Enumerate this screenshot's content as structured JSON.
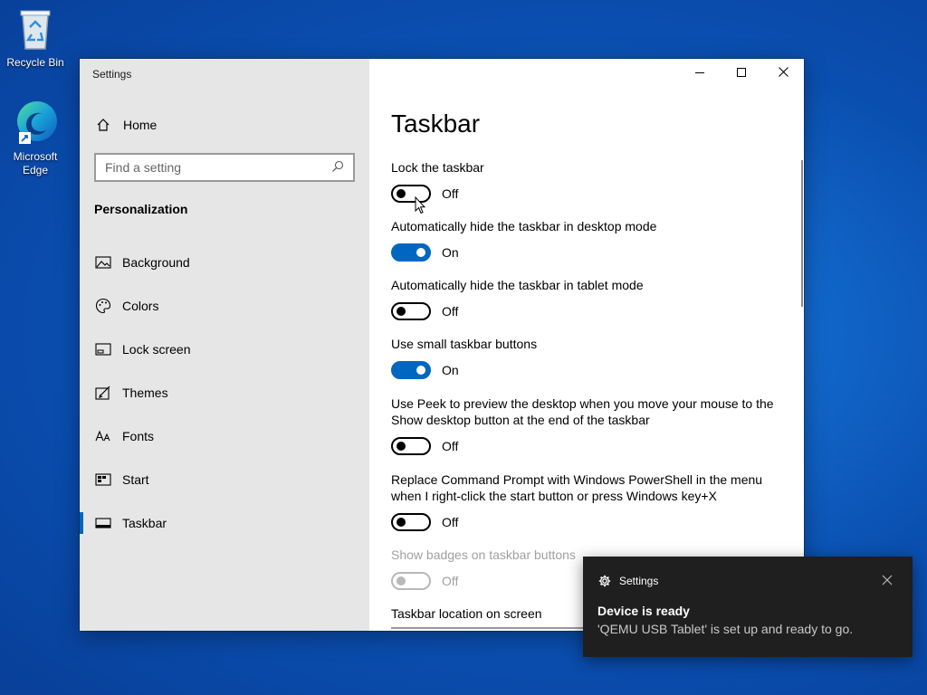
{
  "desktop": {
    "icons": [
      {
        "label": "Recycle Bin",
        "icon": "recycle-bin-icon"
      },
      {
        "label": "Microsoft Edge",
        "icon": "edge-icon"
      }
    ]
  },
  "window": {
    "title": "Settings",
    "caption": {
      "minimize": "minimize-icon",
      "maximize": "maximize-icon",
      "close": "close-icon"
    }
  },
  "sidebar": {
    "home_label": "Home",
    "search_placeholder": "Find a setting",
    "section_title": "Personalization",
    "items": [
      {
        "label": "Background",
        "icon": "background-icon"
      },
      {
        "label": "Colors",
        "icon": "palette-icon"
      },
      {
        "label": "Lock screen",
        "icon": "lock-screen-icon"
      },
      {
        "label": "Themes",
        "icon": "themes-icon"
      },
      {
        "label": "Fonts",
        "icon": "fonts-icon"
      },
      {
        "label": "Start",
        "icon": "start-icon"
      },
      {
        "label": "Taskbar",
        "icon": "taskbar-icon",
        "active": true
      }
    ]
  },
  "content": {
    "title": "Taskbar",
    "settings": [
      {
        "label": "Lock the taskbar",
        "state": "Off",
        "on": false,
        "disabled": false
      },
      {
        "label": "Automatically hide the taskbar in desktop mode",
        "state": "On",
        "on": true,
        "disabled": false
      },
      {
        "label": "Automatically hide the taskbar in tablet mode",
        "state": "Off",
        "on": false,
        "disabled": false
      },
      {
        "label": "Use small taskbar buttons",
        "state": "On",
        "on": true,
        "disabled": false
      },
      {
        "label_line1": "Use Peek to preview the desktop when you move your mouse to the",
        "label_line2": "Show desktop button at the end of the taskbar",
        "state": "Off",
        "on": false,
        "disabled": false
      },
      {
        "label_line1": "Replace Command Prompt with Windows PowerShell in the menu",
        "label_line2": "when I right-click the start button or press Windows key+X",
        "state": "Off",
        "on": false,
        "disabled": false
      },
      {
        "label": "Show badges on taskbar buttons",
        "state": "Off",
        "on": false,
        "disabled": true
      }
    ],
    "location_label": "Taskbar location on screen"
  },
  "toast": {
    "app": "Settings",
    "title": "Device is ready",
    "body": "'QEMU USB Tablet' is set up and ready to go."
  },
  "colors": {
    "accent": "#0067c0",
    "sidebar_bg": "#e6e6e6",
    "toast_bg": "#1f1f1f"
  }
}
